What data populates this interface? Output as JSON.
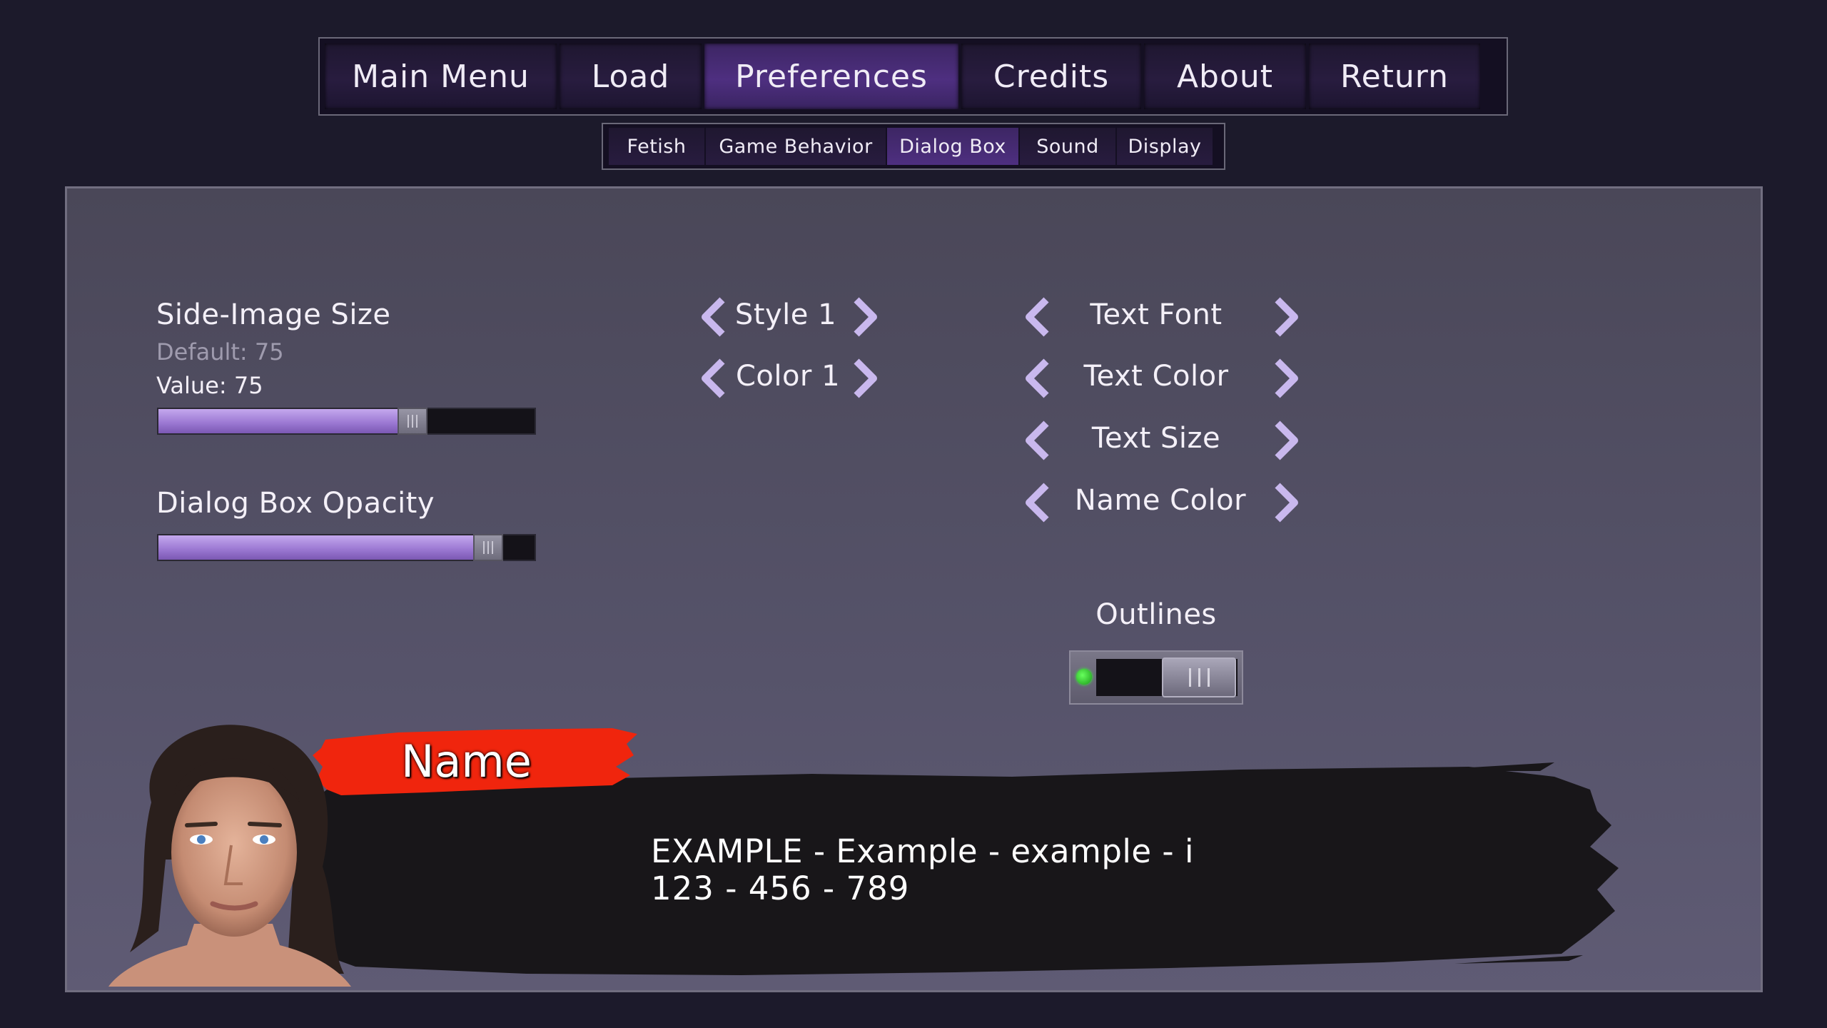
{
  "main_nav": [
    {
      "label": "Main Menu",
      "active": false
    },
    {
      "label": "Load",
      "active": false
    },
    {
      "label": "Preferences",
      "active": true
    },
    {
      "label": "Credits",
      "active": false
    },
    {
      "label": "About",
      "active": false
    },
    {
      "label": "Return",
      "active": false
    }
  ],
  "sub_nav": [
    {
      "label": "Fetish",
      "active": false
    },
    {
      "label": "Game Behavior",
      "active": false
    },
    {
      "label": "Dialog Box",
      "active": true
    },
    {
      "label": "Sound",
      "active": false
    },
    {
      "label": "Display",
      "active": false
    }
  ],
  "side_image": {
    "label": "Side-Image Size",
    "default_text": "Default: 75",
    "value_text": "Value: 75",
    "level_percent": 69
  },
  "opacity": {
    "label": "Dialog Box Opacity",
    "level_percent": 91
  },
  "box_options": {
    "style": "Style 1",
    "color": "Color 1"
  },
  "text_options": {
    "font": "Text Font",
    "color": "Text Color",
    "size": "Text Size",
    "name_color": "Name Color"
  },
  "outlines": {
    "label": "Outlines",
    "enabled": true
  },
  "preview": {
    "name": "Name",
    "line1": "EXAMPLE - Example - example - i",
    "line2": "123 - 456 - 789"
  },
  "colors": {
    "accent": "#a584dc",
    "name_plate": "#f0250d",
    "panel": "#514e63",
    "background": "#1c1a2b"
  }
}
